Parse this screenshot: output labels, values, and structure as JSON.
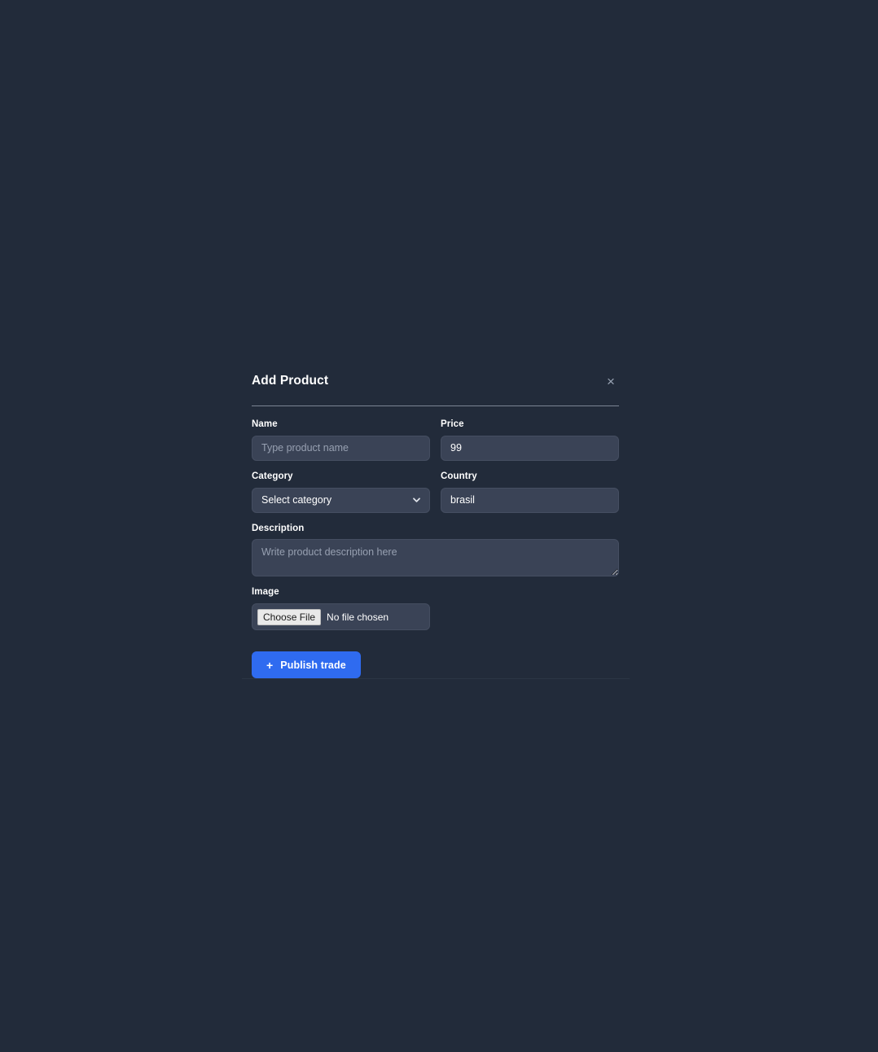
{
  "modal": {
    "title": "Add Product",
    "close_icon": "close-icon",
    "fields": {
      "name": {
        "label": "Name",
        "placeholder": "Type product name",
        "value": ""
      },
      "price": {
        "label": "Price",
        "placeholder": "",
        "value": "99"
      },
      "category": {
        "label": "Category",
        "selected": "Select category",
        "options": [
          "Select category"
        ]
      },
      "country": {
        "label": "Country",
        "placeholder": "",
        "value": "brasil"
      },
      "description": {
        "label": "Description",
        "placeholder": "Write product description here",
        "value": ""
      },
      "image": {
        "label": "Image",
        "choose_button": "Choose File",
        "status": "No file chosen"
      }
    },
    "submit": {
      "label": "Publish trade",
      "icon": "plus-icon"
    }
  },
  "colors": {
    "page_background": "#222b3a",
    "input_background": "#3a4356",
    "accent": "#2f6bf0",
    "text": "#ffffff",
    "placeholder": "#97a0b1",
    "divider": "#8b94a3"
  }
}
